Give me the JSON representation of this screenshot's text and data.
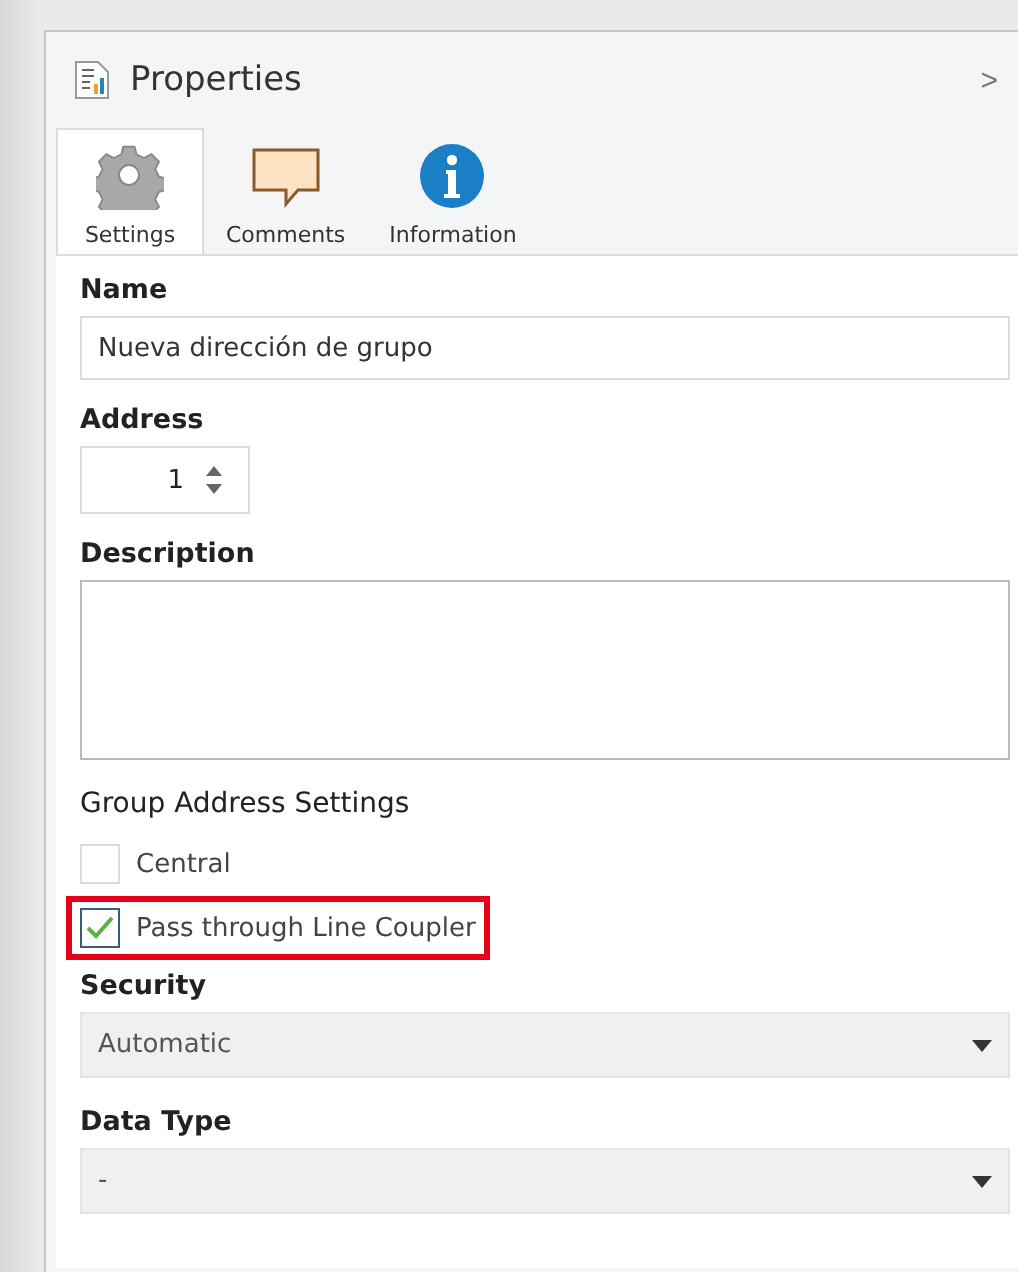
{
  "panel": {
    "title": "Properties",
    "collapse_glyph": ">"
  },
  "tabs": [
    {
      "label": "Settings",
      "kind": "gear",
      "selected": true
    },
    {
      "label": "Comments",
      "kind": "comment",
      "selected": false
    },
    {
      "label": "Information",
      "kind": "info",
      "selected": false
    }
  ],
  "name": {
    "label": "Name",
    "value": "Nueva dirección de grupo"
  },
  "address": {
    "label": "Address",
    "value": "1"
  },
  "description": {
    "label": "Description"
  },
  "group_address_settings": {
    "heading": "Group Address Settings",
    "options": [
      {
        "label": "Central",
        "checked": false,
        "highlighted": false
      },
      {
        "label": "Pass through Line Coupler",
        "checked": true,
        "highlighted": true
      }
    ]
  },
  "security": {
    "label": "Security",
    "value": "Automatic"
  },
  "data_type": {
    "label": "Data Type",
    "value": "-"
  }
}
